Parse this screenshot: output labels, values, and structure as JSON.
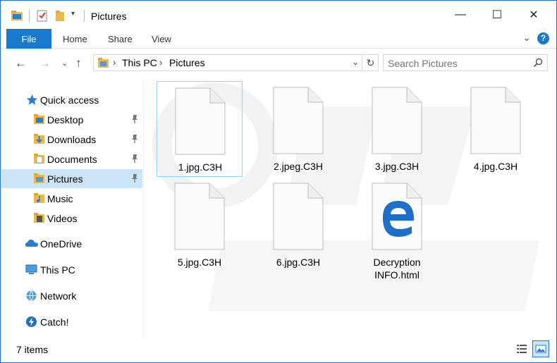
{
  "window": {
    "title": "Pictures",
    "controls": {
      "minimize": "—",
      "maximize": "☐",
      "close": "✕"
    }
  },
  "ribbon": {
    "tabs": [
      "File",
      "Home",
      "Share",
      "View"
    ],
    "help": "?"
  },
  "address": {
    "crumbs": [
      "This PC",
      "Pictures"
    ],
    "search_placeholder": "Search Pictures"
  },
  "sidebar": {
    "items": [
      {
        "label": "Quick access",
        "icon": "star-icon"
      },
      {
        "label": "Desktop",
        "icon": "desktop-folder-icon",
        "pinned": true
      },
      {
        "label": "Downloads",
        "icon": "downloads-folder-icon",
        "pinned": true
      },
      {
        "label": "Documents",
        "icon": "documents-folder-icon",
        "pinned": true
      },
      {
        "label": "Pictures",
        "icon": "pictures-folder-icon",
        "pinned": true,
        "selected": true
      },
      {
        "label": "Music",
        "icon": "music-folder-icon"
      },
      {
        "label": "Videos",
        "icon": "videos-folder-icon"
      },
      {
        "label": "OneDrive",
        "icon": "cloud-icon"
      },
      {
        "label": "This PC",
        "icon": "computer-icon"
      },
      {
        "label": "Network",
        "icon": "network-icon"
      },
      {
        "label": "Catch!",
        "icon": "catch-icon"
      }
    ]
  },
  "files": [
    {
      "name": "1.jpg.C3H",
      "type": "blank"
    },
    {
      "name": "2.jpeg.C3H",
      "type": "blank"
    },
    {
      "name": "3.jpg.C3H",
      "type": "blank"
    },
    {
      "name": "4.jpg.C3H",
      "type": "blank"
    },
    {
      "name": "5.jpg.C3H",
      "type": "blank"
    },
    {
      "name": "6.jpg.C3H",
      "type": "blank"
    },
    {
      "name_line1": "Decryption",
      "name_line2": "INFO.html",
      "type": "edge-html"
    }
  ],
  "status": {
    "count": "7 items"
  },
  "colors": {
    "accent": "#1979ca",
    "selection": "#cce4f7",
    "edge_blue": "#1e6fc8"
  }
}
